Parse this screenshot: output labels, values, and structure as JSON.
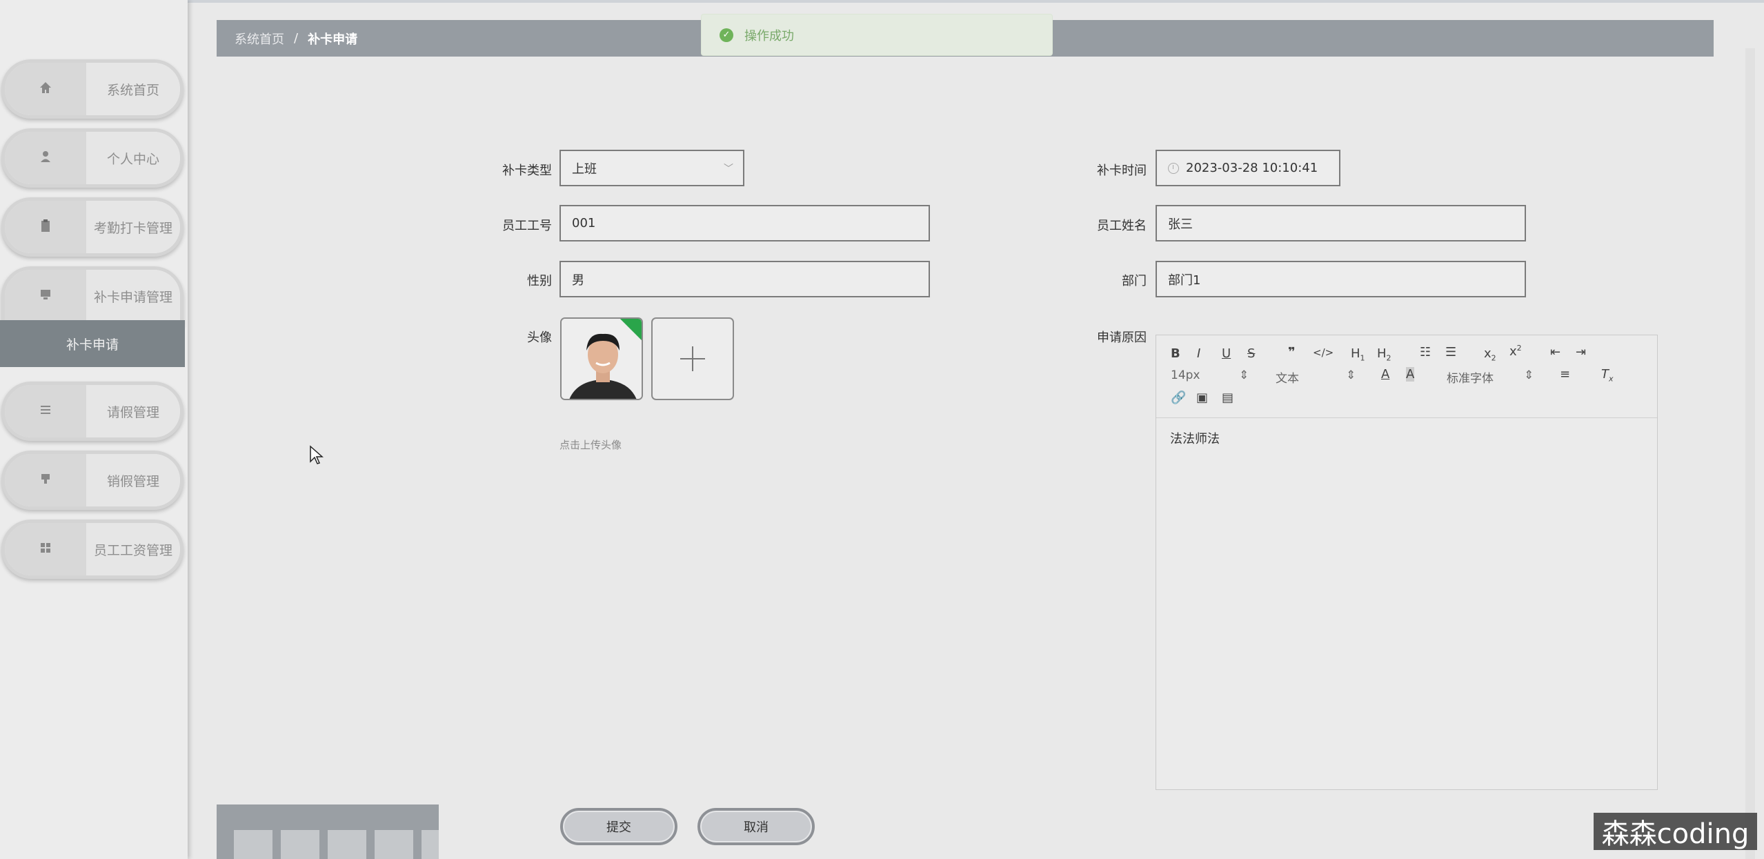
{
  "breadcrumb": {
    "home": "系统首页",
    "separator": "/",
    "current": "补卡申请"
  },
  "toast": {
    "message": "操作成功"
  },
  "sidebar": {
    "items": [
      {
        "label": "系统首页",
        "icon": "home-icon"
      },
      {
        "label": "个人中心",
        "icon": "user-icon"
      },
      {
        "label": "考勤打卡管理",
        "icon": "clipboard-icon"
      },
      {
        "label": "补卡申请管理",
        "icon": "monitor-icon"
      },
      {
        "label": "请假管理",
        "icon": "list-icon"
      },
      {
        "label": "销假管理",
        "icon": "stamp-icon"
      },
      {
        "label": "员工工资管理",
        "icon": "grid-icon"
      }
    ],
    "sub_item": "补卡申请"
  },
  "form": {
    "type_label": "补卡类型",
    "type_value": "上班",
    "time_label": "补卡时间",
    "time_value": "2023-03-28 10:10:41",
    "emp_no_label": "员工工号",
    "emp_no_value": "001",
    "emp_name_label": "员工姓名",
    "emp_name_value": "张三",
    "gender_label": "性别",
    "gender_value": "男",
    "dept_label": "部门",
    "dept_value": "部门1",
    "avatar_label": "头像",
    "avatar_hint": "点击上传头像",
    "reason_label": "申请原因"
  },
  "editor": {
    "font_size": "14px",
    "text_type": "文本",
    "font_family": "标准字体",
    "content": "法法师法"
  },
  "buttons": {
    "submit": "提交",
    "cancel": "取消"
  },
  "watermark": "森森coding"
}
